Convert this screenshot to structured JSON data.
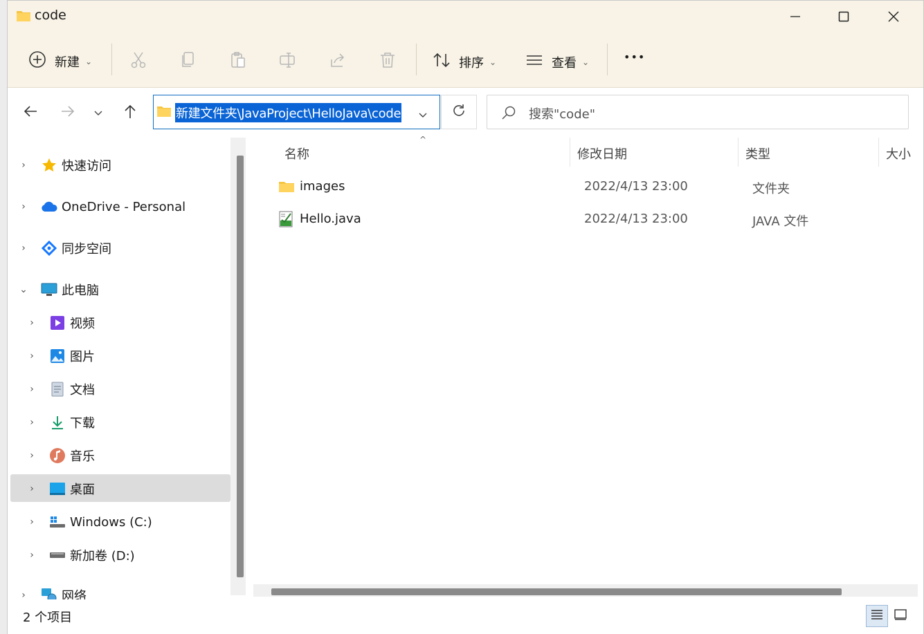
{
  "window": {
    "title": "code"
  },
  "toolbar": {
    "new_label": "新建",
    "sort_label": "排序",
    "view_label": "查看",
    "more_label": "•••"
  },
  "address": {
    "path": "新建文件夹\\JavaProject\\HelloJava\\code",
    "search_placeholder": "搜索\"code\""
  },
  "sidebar": {
    "items": [
      {
        "label": "快速访问",
        "icon": "star-icon",
        "expanded": false
      },
      {
        "label": "OneDrive - Personal",
        "icon": "onedrive-cloud-icon",
        "expanded": false
      },
      {
        "label": "同步空间",
        "icon": "sync-space-icon",
        "expanded": false
      },
      {
        "label": "此电脑",
        "icon": "computer-icon",
        "expanded": true
      },
      {
        "label": "视频",
        "icon": "video-icon",
        "expanded": false
      },
      {
        "label": "图片",
        "icon": "pictures-icon",
        "expanded": false
      },
      {
        "label": "文档",
        "icon": "documents-icon",
        "expanded": false
      },
      {
        "label": "下载",
        "icon": "download-icon",
        "expanded": false
      },
      {
        "label": "音乐",
        "icon": "music-icon",
        "expanded": false
      },
      {
        "label": "桌面",
        "icon": "desktop-icon",
        "expanded": false,
        "selected": true
      },
      {
        "label": "Windows (C:)",
        "icon": "windows-drive-icon",
        "expanded": false
      },
      {
        "label": "新加卷 (D:)",
        "icon": "drive-icon",
        "expanded": false
      },
      {
        "label": "网络",
        "icon": "network-icon",
        "expanded": false
      }
    ]
  },
  "columns": {
    "name": "名称",
    "modified": "修改日期",
    "type": "类型",
    "size": "大小"
  },
  "files": [
    {
      "name": "images",
      "modified": "2022/4/13 23:00",
      "type": "文件夹",
      "icon": "folder-icon"
    },
    {
      "name": "Hello.java",
      "modified": "2022/4/13 23:00",
      "type": "JAVA 文件",
      "icon": "java-file-icon"
    }
  ],
  "status": {
    "count_text": "2 个项目"
  },
  "colors": {
    "titlebar_bg": "#f8f3e6",
    "selection_blue": "#0a64d6",
    "folder_yellow": "#f5c542"
  }
}
